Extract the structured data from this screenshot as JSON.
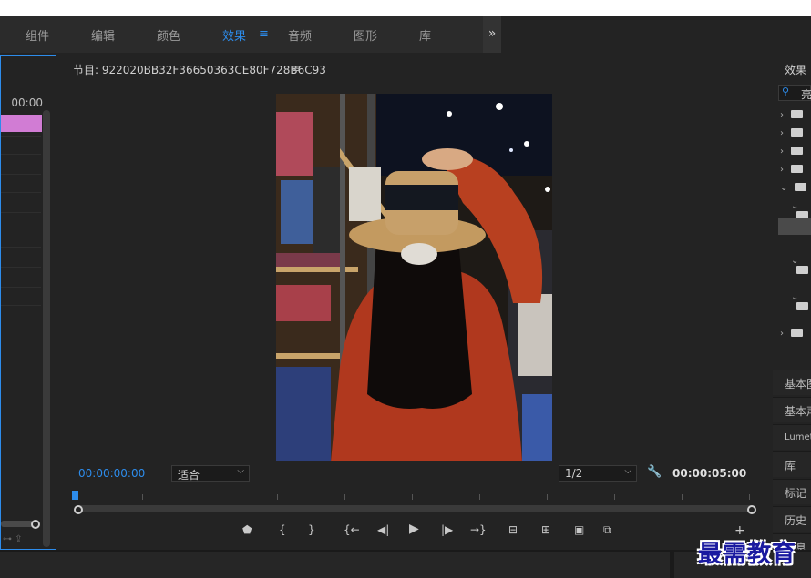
{
  "workspace_tabs": [
    {
      "label": "组件",
      "active": false
    },
    {
      "label": "编辑",
      "active": false
    },
    {
      "label": "颜色",
      "active": false
    },
    {
      "label": "效果",
      "active": true
    },
    {
      "label": "音频",
      "active": false
    },
    {
      "label": "图形",
      "active": false
    },
    {
      "label": "库",
      "active": false
    }
  ],
  "workspace_menu_icon": "hamburger-icon",
  "workspace_overflow": "»",
  "timeline": {
    "timecode": "00:00"
  },
  "monitor": {
    "title": "节目: 922020BB32F36650363CE80F728B6C93",
    "menu_icon": "≡",
    "current_time": "00:00:00:00",
    "zoom_select": "适合",
    "resolution_select": "1/2",
    "duration": "00:00:05:00"
  },
  "transport_controls": [
    {
      "name": "add-marker-button",
      "glyph": "⬟"
    },
    {
      "name": "mark-in-button",
      "glyph": "{"
    },
    {
      "name": "mark-out-button",
      "glyph": "}"
    },
    {
      "name": "go-to-in-button",
      "glyph": "{←"
    },
    {
      "name": "step-back-button",
      "glyph": "◀|"
    },
    {
      "name": "play-button",
      "glyph": "▶"
    },
    {
      "name": "step-forward-button",
      "glyph": "|▶"
    },
    {
      "name": "go-to-out-button",
      "glyph": "→}"
    },
    {
      "name": "lift-button",
      "glyph": "⊟"
    },
    {
      "name": "extract-button",
      "glyph": "⊞"
    },
    {
      "name": "export-frame-button",
      "glyph": "📷"
    },
    {
      "name": "compare-view-button",
      "glyph": "▣"
    }
  ],
  "effects_panel": {
    "title": "效果",
    "search_text": "亮",
    "bottom_tabs": [
      "基本图",
      "基本声",
      "Lumetri",
      "库",
      "标记",
      "历史",
      "信息"
    ]
  },
  "watermark": "最需教育",
  "colors": {
    "accent": "#2d8ceb",
    "clip": "#d17cd4",
    "panel_bg": "#232323"
  }
}
